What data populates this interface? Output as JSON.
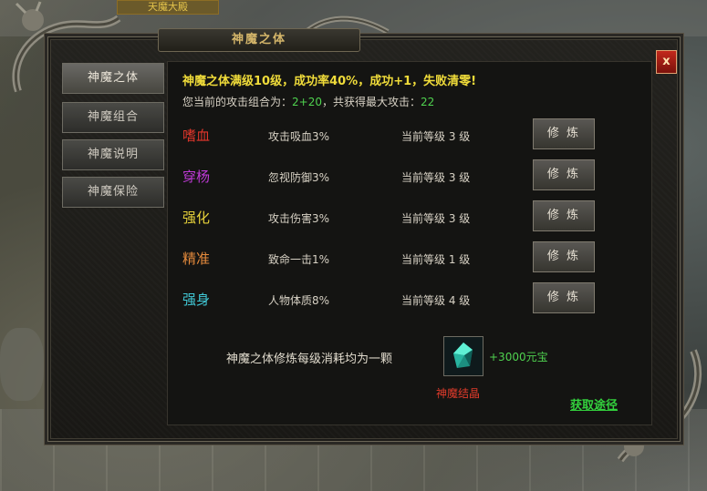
{
  "background": {
    "banner_text": "天魔大殿"
  },
  "window": {
    "title": "神魔之体",
    "close_label": "x"
  },
  "menu": [
    {
      "label": "神魔之体",
      "active": true
    },
    {
      "label": "神魔组合",
      "active": false
    },
    {
      "label": "神魔说明",
      "active": false
    },
    {
      "label": "神魔保险",
      "active": false
    }
  ],
  "main": {
    "headline": "神魔之体满级10级，成功率40%，成功+1，失败清零!",
    "attack_prefix": "您当前的攻击组合为：",
    "attack_combo": "2+20",
    "attack_mid": "，共获得最大攻击：",
    "attack_max": "22",
    "rows": [
      {
        "name": "嗜血",
        "color": "#e0362b",
        "desc": "攻击吸血3%",
        "level": "当前等级 3 级",
        "button": "修 炼"
      },
      {
        "name": "穿杨",
        "color": "#c03ad8",
        "desc": "忽视防御3%",
        "level": "当前等级 3 级",
        "button": "修 炼"
      },
      {
        "name": "强化",
        "color": "#e7d23a",
        "desc": "攻击伤害3%",
        "level": "当前等级 3 级",
        "button": "修 炼"
      },
      {
        "name": "精准",
        "color": "#e48a3c",
        "desc": "致命一击1%",
        "level": "当前等级 1 级",
        "button": "修 炼"
      },
      {
        "name": "强身",
        "color": "#41c9d6",
        "desc": "人物体质8%",
        "level": "当前等级 4 级",
        "button": "修 炼"
      }
    ],
    "cost_text": "神魔之体修炼每级消耗均为一颗",
    "price_text": "+3000元宝",
    "crystal_name": "神魔结晶",
    "crystal_icon": "gem-icon",
    "get_link": "获取途径"
  }
}
